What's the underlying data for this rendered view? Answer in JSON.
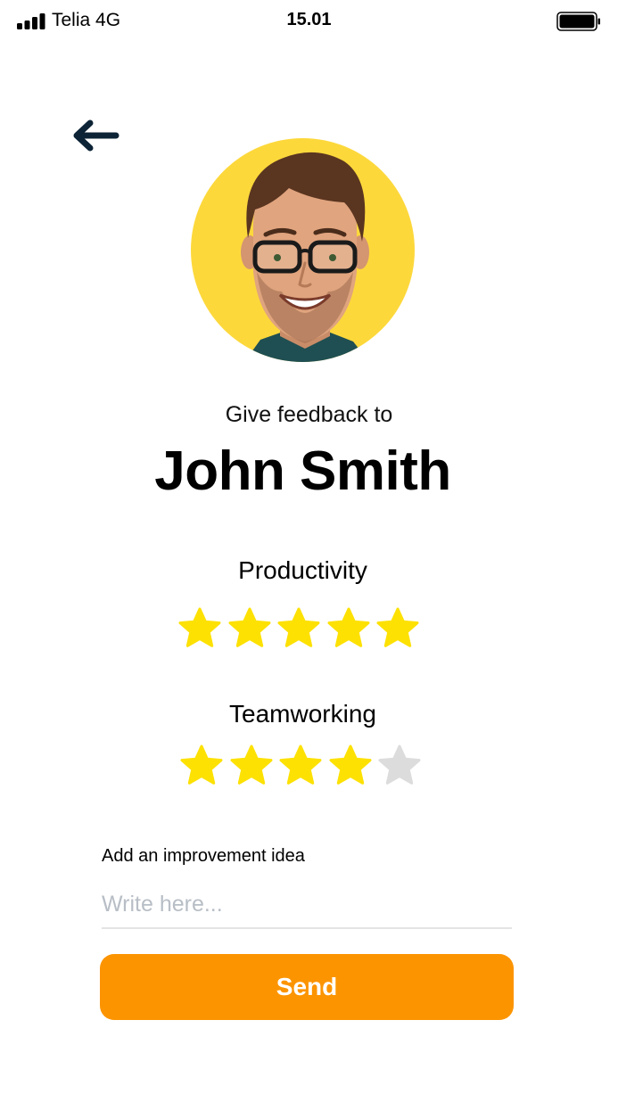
{
  "status_bar": {
    "carrier": "Telia  4G",
    "time": "15.01",
    "signal_icon": "signal-bars-icon",
    "battery_icon": "battery-full-icon"
  },
  "nav": {
    "back_icon": "arrow-left-icon"
  },
  "profile": {
    "avatar_icon": "user-photo",
    "subtitle": "Give feedback to",
    "name": "John Smith"
  },
  "ratings": [
    {
      "label": "Productivity",
      "value": 5,
      "max": 5
    },
    {
      "label": "Teamworking",
      "value": 4,
      "max": 5
    }
  ],
  "improvement": {
    "label": "Add an improvement idea",
    "placeholder": "Write here...",
    "value": ""
  },
  "send": {
    "label": "Send"
  },
  "colors": {
    "accent": "#fc9400",
    "star_filled": "#fde103",
    "star_empty": "#dcdcdc",
    "avatar_background": "#fdd83b",
    "back_arrow": "#0d2436"
  }
}
